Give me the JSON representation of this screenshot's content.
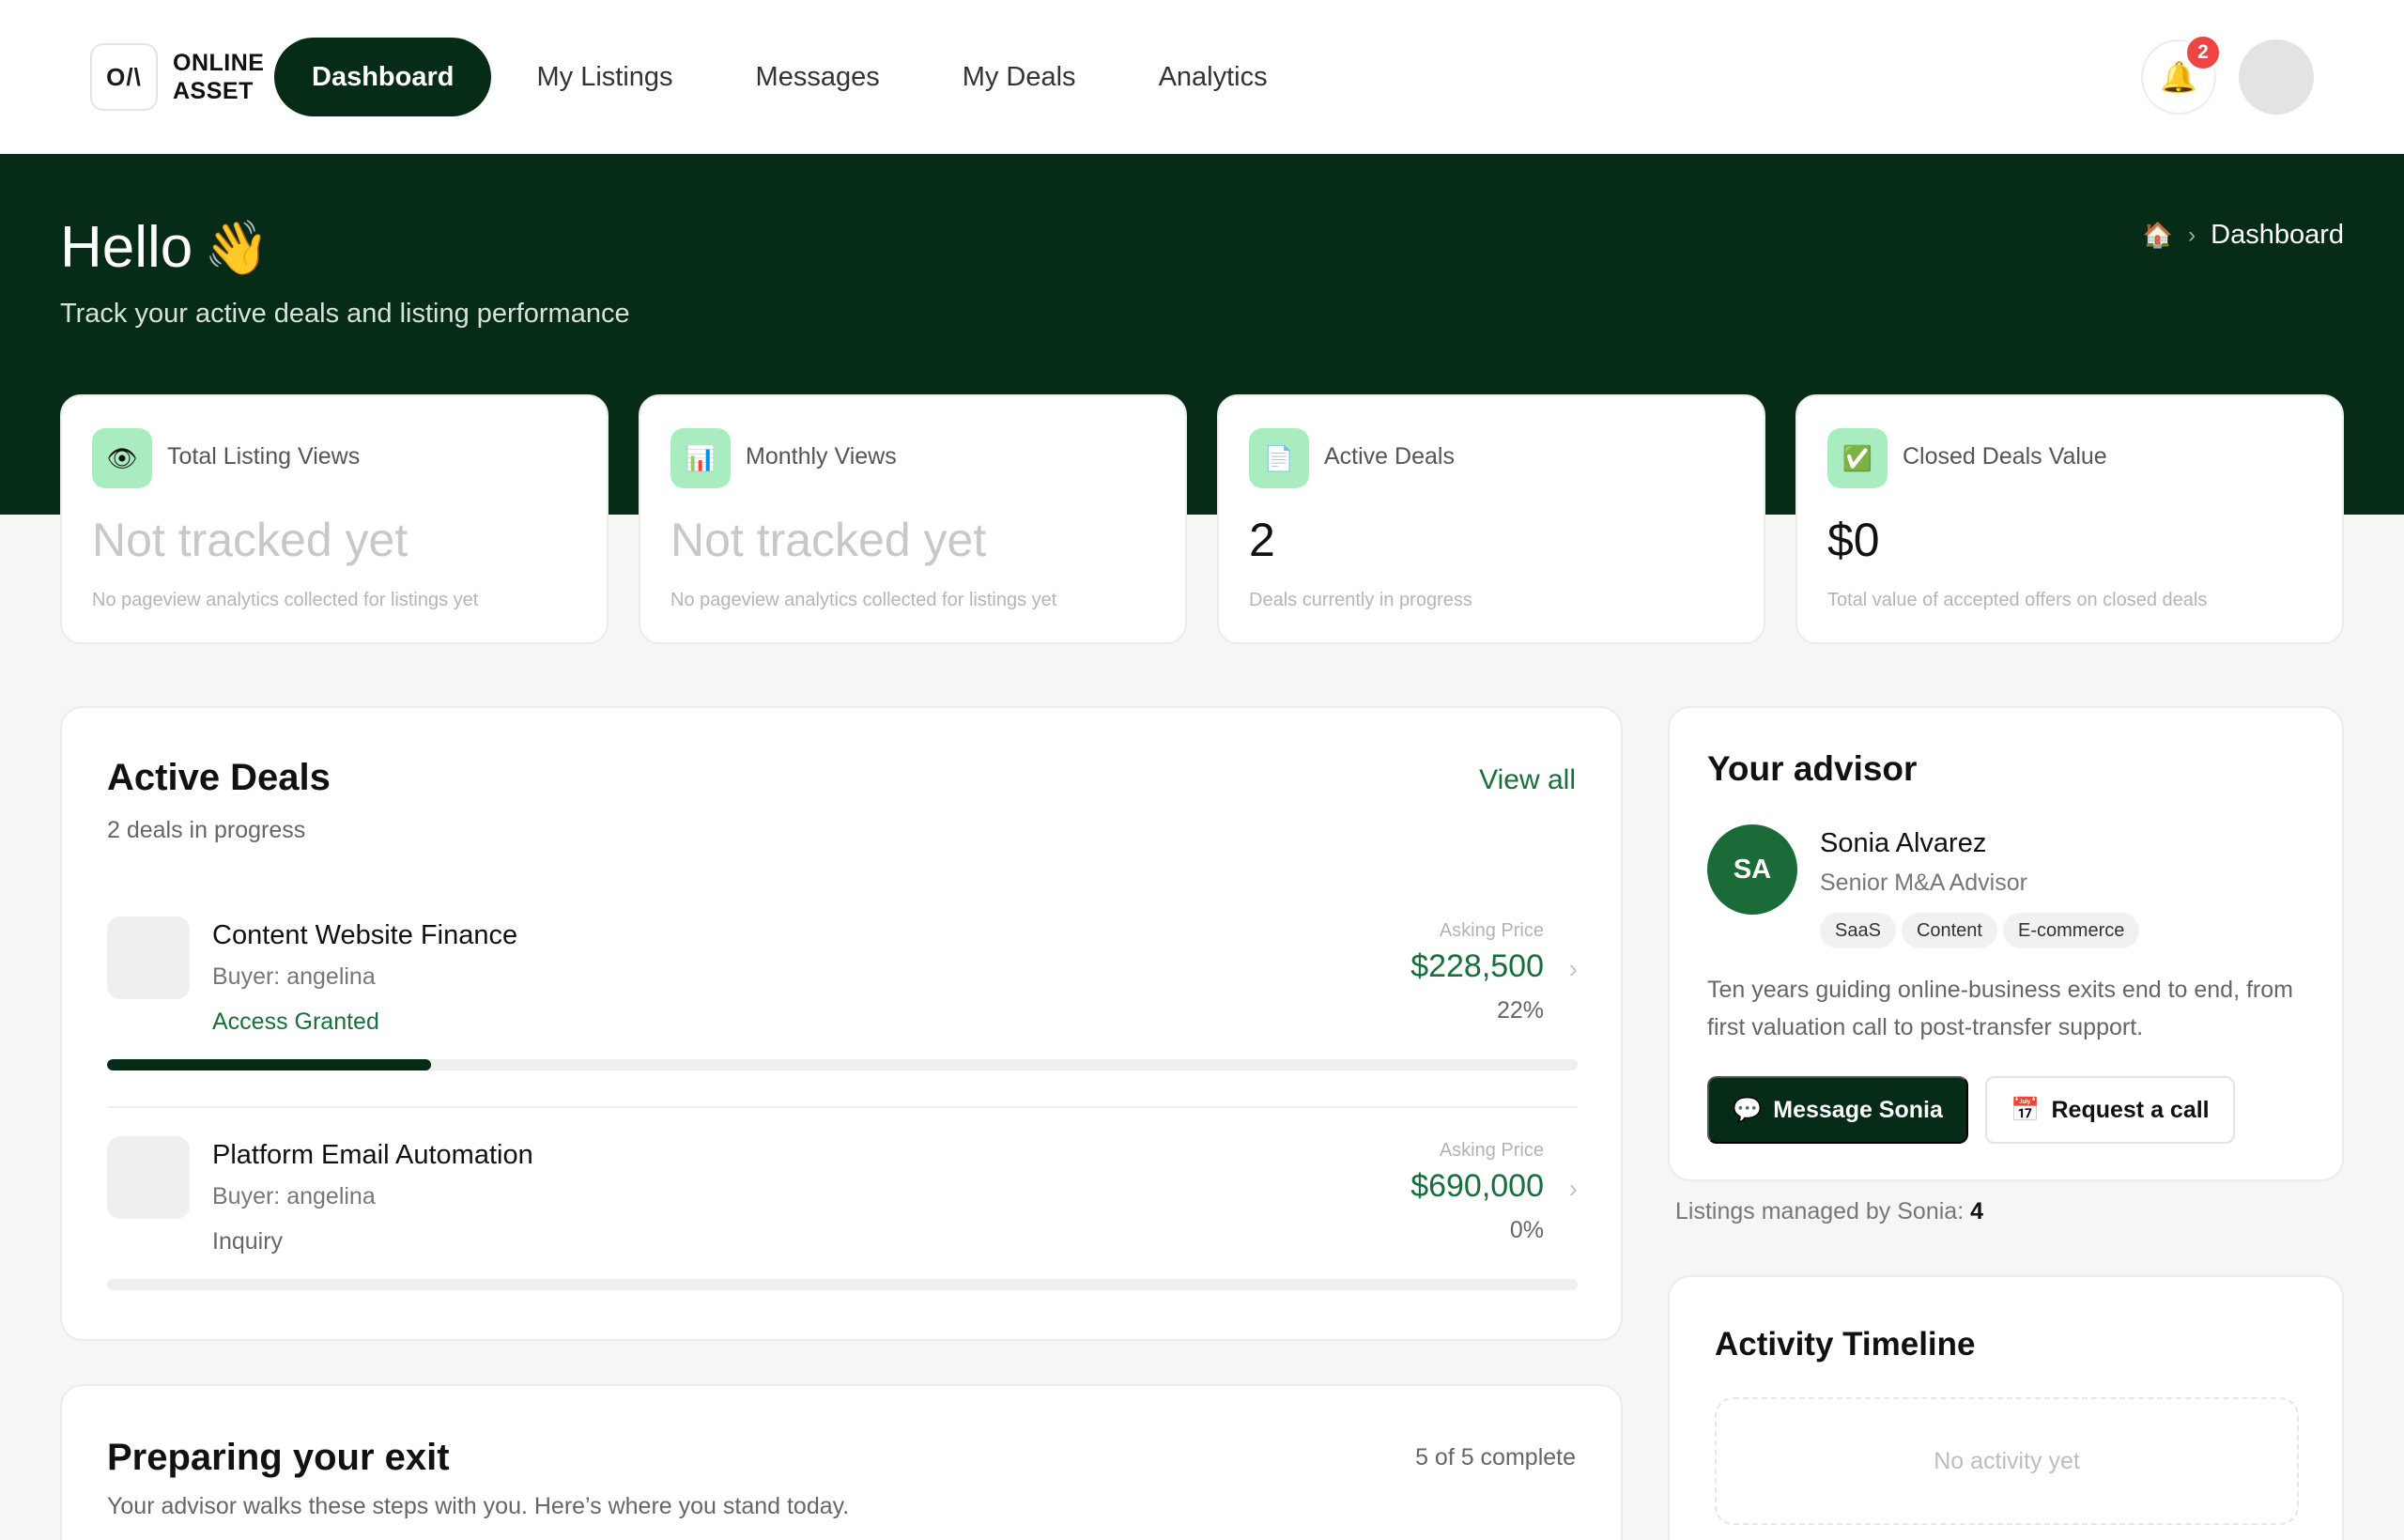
{
  "brand": {
    "mark": "O/\\",
    "line1": "ONLINE",
    "line2": "ASSET"
  },
  "nav": {
    "items": [
      {
        "label": "Dashboard",
        "active": true
      },
      {
        "label": "My Listings"
      },
      {
        "label": "Messages"
      },
      {
        "label": "My Deals"
      },
      {
        "label": "Analytics"
      }
    ],
    "notification_count": "2",
    "bell_icon": "🔔"
  },
  "hero": {
    "greeting": "Hello",
    "wave": "👋",
    "subtitle": "Track your active deals and listing performance",
    "breadcrumb": {
      "home_icon": "🏠",
      "separator": "›",
      "current": "Dashboard"
    }
  },
  "stats": [
    {
      "icon": "👁",
      "label": "Total Listing Views",
      "value": "Not tracked yet",
      "note": "No pageview analytics collected for listings yet"
    },
    {
      "icon": "📊",
      "label": "Monthly Views",
      "value": "Not tracked yet",
      "note": "No pageview analytics collected for listings yet"
    },
    {
      "icon": "📄",
      "label": "Active Deals",
      "value": "2",
      "note": "Deals currently in progress"
    },
    {
      "icon": "✅",
      "label": "Closed Deals Value",
      "value": "$0",
      "note": "Total value of accepted offers on closed deals"
    }
  ],
  "active_deals": {
    "title": "Active Deals",
    "subtitle": "2 deals in progress",
    "view_all": "View all",
    "asking_label": "Asking Price",
    "deals": [
      {
        "name": "Content Website Finance",
        "buyer": "Buyer: angelina",
        "status": "Access Granted",
        "price": "$228,500",
        "percent": "22%",
        "progress": 0.22
      },
      {
        "name": "Platform Email Automation",
        "buyer": "Buyer: angelina",
        "status": "Inquiry",
        "price": "$690,000",
        "percent": "0%",
        "progress": 0
      }
    ]
  },
  "exit": {
    "title": "Preparing your exit",
    "subtitle": "Your advisor walks these steps with you. Here’s where you stand today.",
    "count": "5 of 5 complete"
  },
  "advisor": {
    "title": "Your advisor",
    "initials": "SA",
    "name": "Sonia Alvarez",
    "role": "Senior M&A Advisor",
    "tags": [
      "SaaS",
      "Content",
      "E-commerce"
    ],
    "bio": "Ten years guiding online-business exits end to end, from first valuation call to post-transfer support.",
    "message_btn": "Message Sonia",
    "message_icon": "💬",
    "call_btn": "Request a call",
    "call_icon": "📅",
    "managed_label": "Listings managed by Sonia:",
    "managed_count": "4"
  },
  "activity": {
    "title": "Activity Timeline",
    "empty": "No activity yet"
  },
  "colors": {
    "brand_dark": "#062b17",
    "accent_green": "#15703a",
    "icon_bg": "#a8ecc0",
    "badge_red": "#ef4444"
  }
}
